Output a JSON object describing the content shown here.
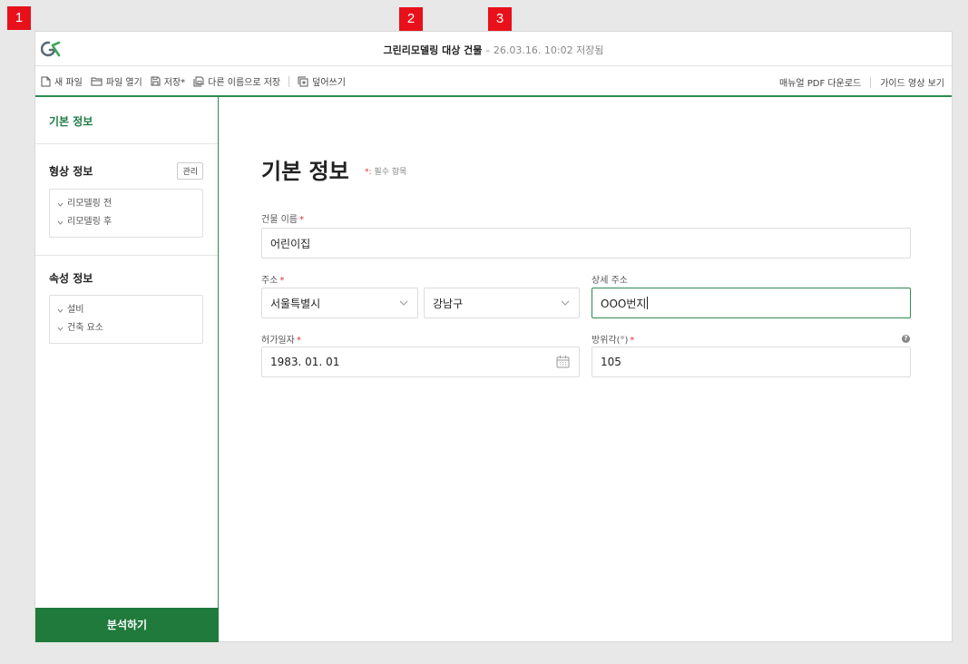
{
  "markers": [
    "1",
    "2",
    "3"
  ],
  "title": {
    "project_name": "그린리모델링 대상 건물",
    "separator": "–",
    "saved_text": "26.03.16. 10:02 저장됨"
  },
  "toolbar": {
    "new_file": "새 파일",
    "open_file": "파일 열기",
    "save": "저장*",
    "save_as": "다른 이름으로 저장",
    "overwrite": "덮어쓰기",
    "manual_pdf": "매뉴얼 PDF 다운로드",
    "guide_video": "가이드 영상 보기"
  },
  "sidebar": {
    "basic_info": "기본 정보",
    "shape_info": {
      "title": "형상 정보",
      "manage_label": "관리",
      "items": [
        "리모델링 전",
        "리모델링 후"
      ]
    },
    "attr_info": {
      "title": "속성 정보",
      "items": [
        "설비",
        "건축 요소"
      ]
    },
    "analyze_label": "분석하기"
  },
  "form": {
    "title": "기본 정보",
    "required_note": "필수 항목",
    "required_mark": "*:",
    "building_name": {
      "label": "건물 이름",
      "value": "어린이집"
    },
    "address": {
      "label": "주소",
      "city": "서울특별시",
      "district": "강남구"
    },
    "detail_address": {
      "label": "상세 주소",
      "value": "OOO번지"
    },
    "permit_date": {
      "label": "허가일자",
      "value": "1983. 01. 01"
    },
    "azimuth": {
      "label": "방위각(°)",
      "value": "105"
    }
  },
  "colors": {
    "brand_green": "#1f7a3c",
    "required_red": "#e0303a",
    "marker_red": "#e8101a"
  },
  "icons": [
    "logo",
    "file-icon",
    "folder-icon",
    "save-icon",
    "save-as-icon",
    "overwrite-icon",
    "chevron-down-icon",
    "calendar-icon",
    "help-icon"
  ]
}
